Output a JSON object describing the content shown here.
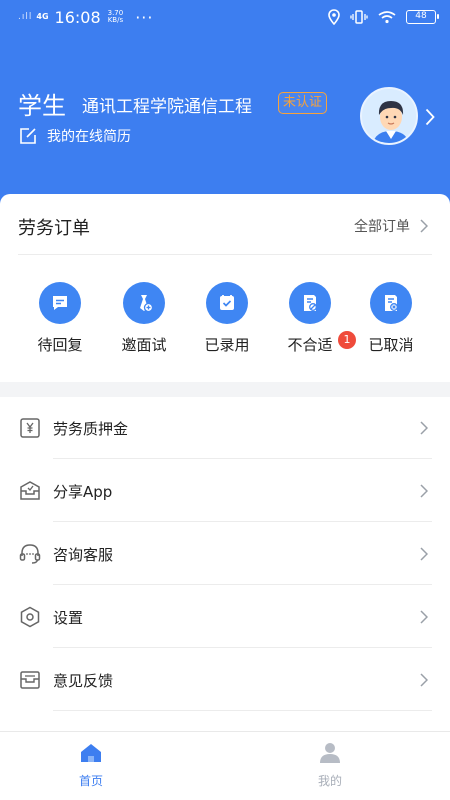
{
  "status_bar": {
    "signal": ".ıll",
    "network": "4G",
    "time": "16:08",
    "speed_value": "3.70",
    "speed_unit": "KB/s",
    "dots": "···",
    "battery": "48"
  },
  "profile": {
    "name": "学生",
    "school": "通讯工程学院通信工程",
    "badge": "未认证",
    "resume_label": "我的在线简历",
    "avatar_icon": "student-avatar-icon"
  },
  "orders": {
    "title": "劳务订单",
    "all_label": "全部订单",
    "items": [
      {
        "label": "待回复",
        "icon": "chat-icon"
      },
      {
        "label": "邀面试",
        "icon": "invite-icon"
      },
      {
        "label": "已录用",
        "icon": "check-doc-icon"
      },
      {
        "label": "不合适",
        "icon": "reject-doc-icon",
        "badge": "1"
      },
      {
        "label": "已取消",
        "icon": "cancel-doc-icon"
      }
    ]
  },
  "menu": [
    {
      "label": "劳务质押金",
      "icon": "yuan-icon"
    },
    {
      "label": "分享App",
      "icon": "share-icon"
    },
    {
      "label": "咨询客服",
      "icon": "headset-icon"
    },
    {
      "label": "设置",
      "icon": "settings-icon"
    },
    {
      "label": "意见反馈",
      "icon": "feedback-icon"
    }
  ],
  "tabbar": {
    "items": [
      {
        "label": "首页",
        "icon": "home-icon",
        "active": true
      },
      {
        "label": "我的",
        "icon": "user-icon",
        "active": false
      }
    ]
  },
  "colors": {
    "primary": "#3d7ef0",
    "badge_orange": "#f6a23c",
    "notification_red": "#ef4b3b",
    "inactive_tab": "#a8aeb8"
  }
}
